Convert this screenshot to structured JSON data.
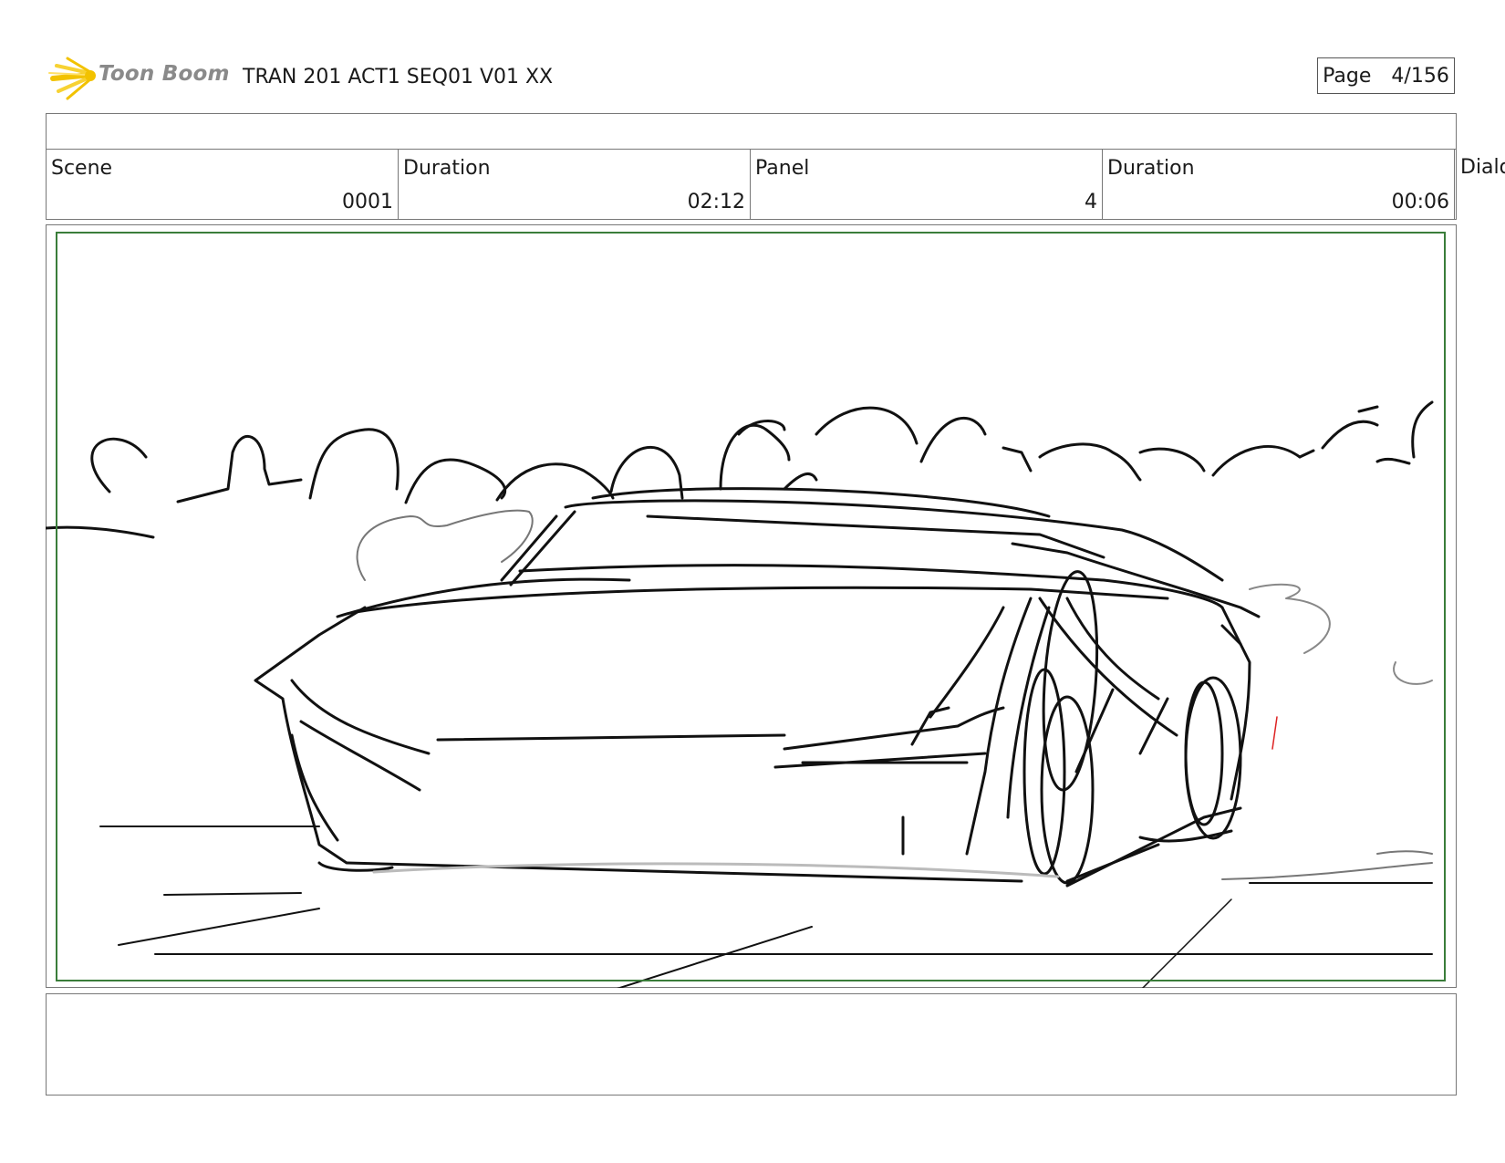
{
  "header": {
    "logo_text": "Toon Boom",
    "project_title": "TRAN 201 ACT1 SEQ01 V01 XX",
    "page_label": "Page",
    "page_value": "4/156"
  },
  "info": {
    "scene_label": "Scene",
    "scene_value": "0001",
    "scene_duration_label": "Duration",
    "scene_duration_value": "02:12",
    "panel_label": "Panel",
    "panel_value": "4",
    "panel_duration_label": "Duration",
    "panel_duration_value": "00:06",
    "dialog_label": "Dialo"
  },
  "colors": {
    "safe_frame": "#3a7d3a",
    "logo_yellow": "#f2c200",
    "border": "#777777"
  }
}
